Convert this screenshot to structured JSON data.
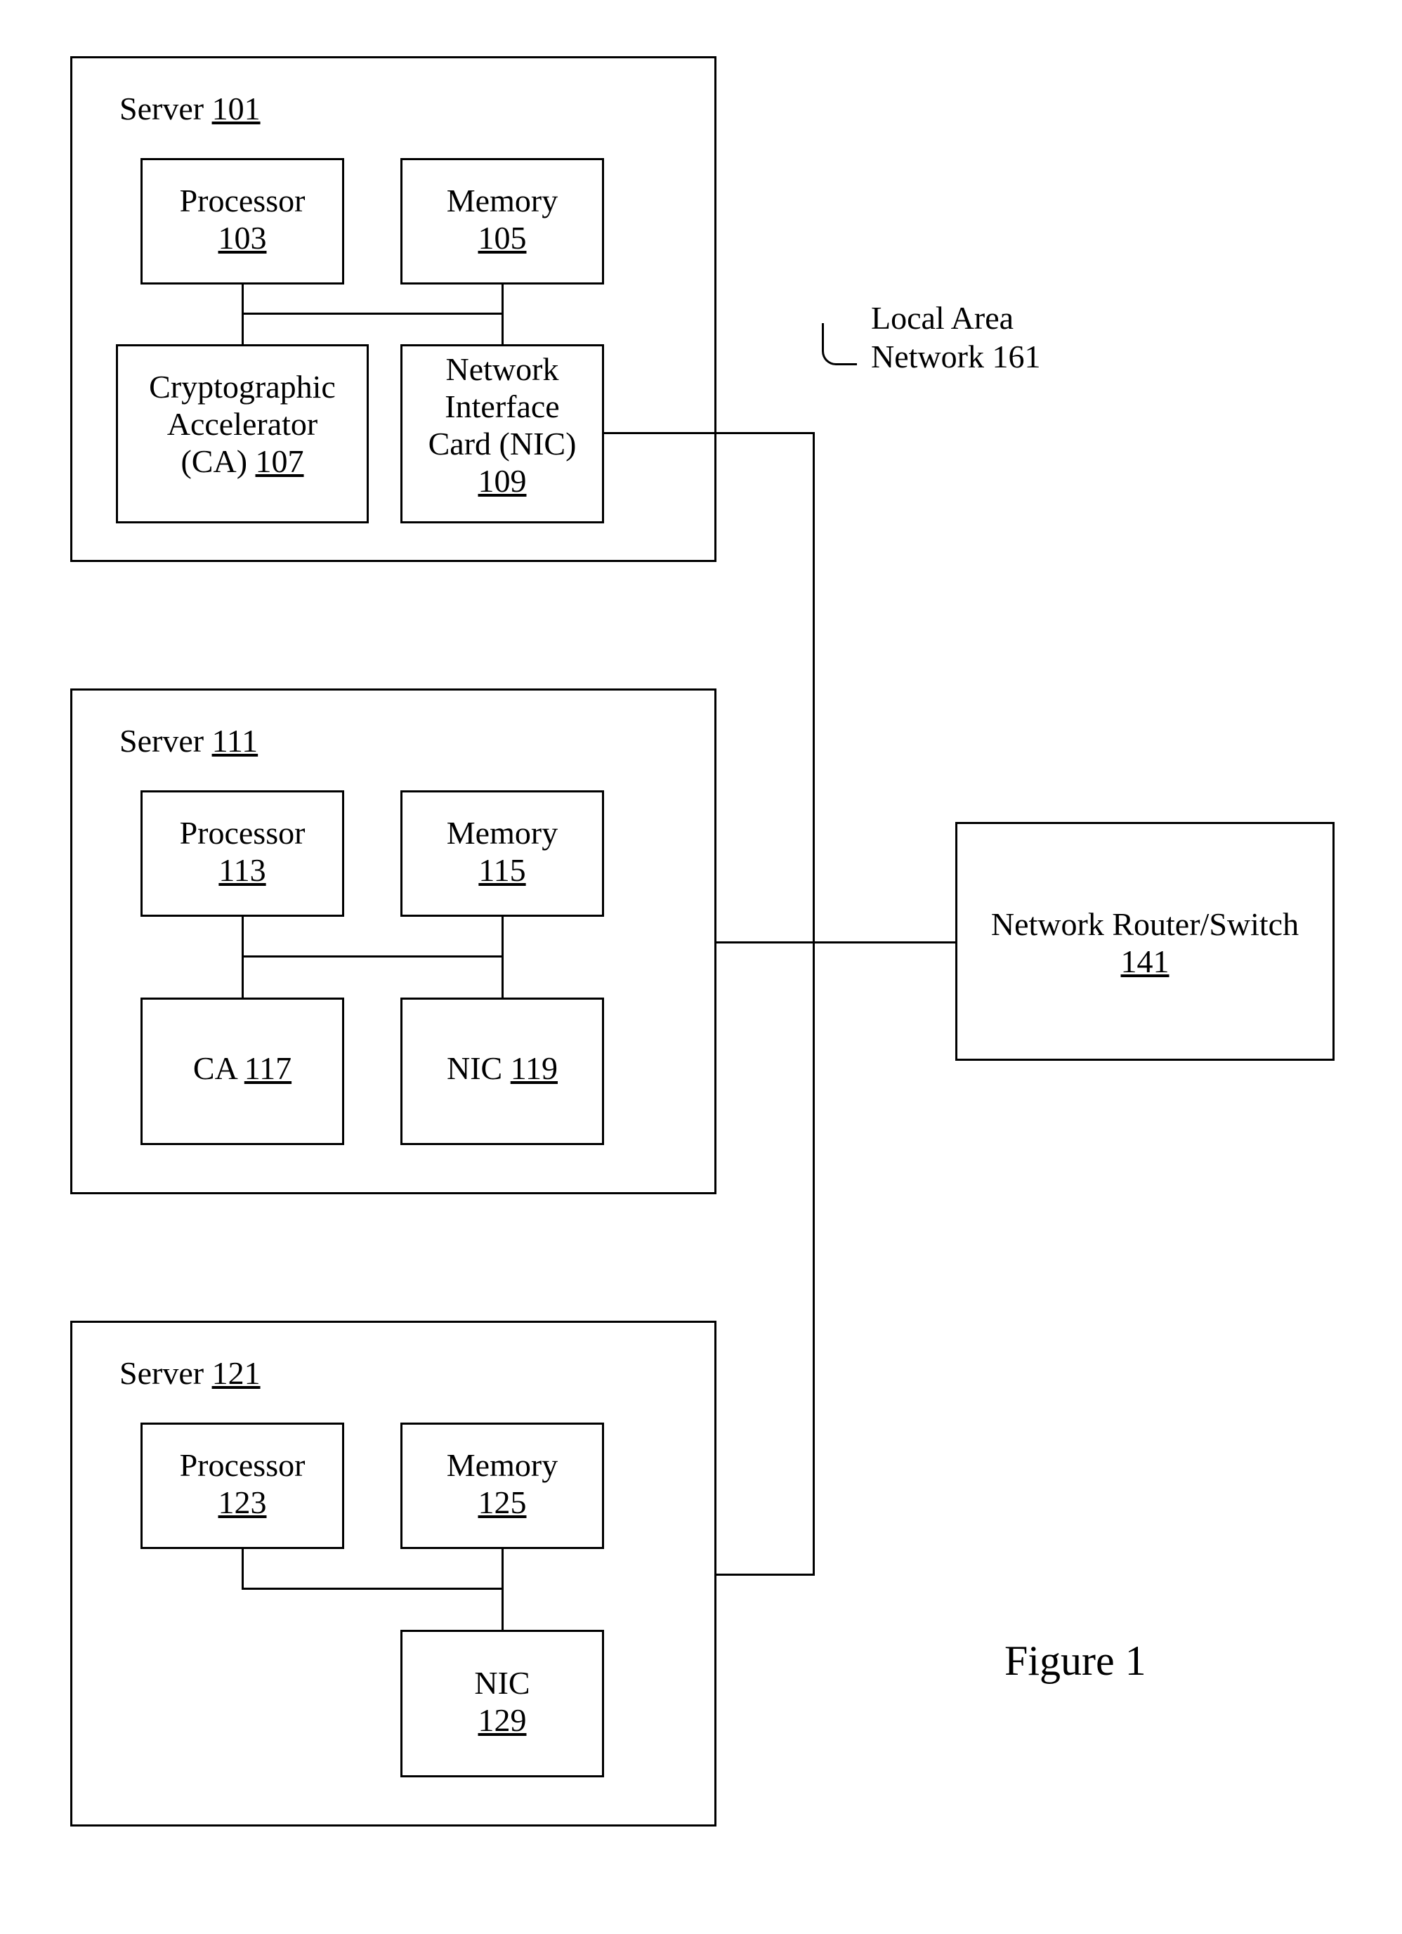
{
  "servers": [
    {
      "title_prefix": "Server ",
      "title_num": "101",
      "components": {
        "proc_label": "Processor",
        "proc_num": "103",
        "mem_label": "Memory",
        "mem_num": "105",
        "ca_line1": "Cryptographic",
        "ca_line2": "Accelerator",
        "ca_line3_prefix": "(CA) ",
        "ca_num": "107",
        "nic_line1": "Network",
        "nic_line2": "Interface",
        "nic_line3": "Card (NIC)",
        "nic_num": "109"
      }
    },
    {
      "title_prefix": "Server ",
      "title_num": "111",
      "components": {
        "proc_label": "Processor",
        "proc_num": "113",
        "mem_label": "Memory",
        "mem_num": "115",
        "ca_prefix": "CA ",
        "ca_num": "117",
        "nic_prefix": "NIC ",
        "nic_num": "119"
      }
    },
    {
      "title_prefix": "Server ",
      "title_num": "121",
      "components": {
        "proc_label": "Processor",
        "proc_num": "123",
        "mem_label": "Memory",
        "mem_num": "125",
        "nic_label": "NIC",
        "nic_num": "129"
      }
    }
  ],
  "router": {
    "line1": "Network Router/Switch",
    "num": "141"
  },
  "lan": {
    "line1": "Local Area",
    "line2": "Network 161"
  },
  "figure_caption": "Figure 1"
}
